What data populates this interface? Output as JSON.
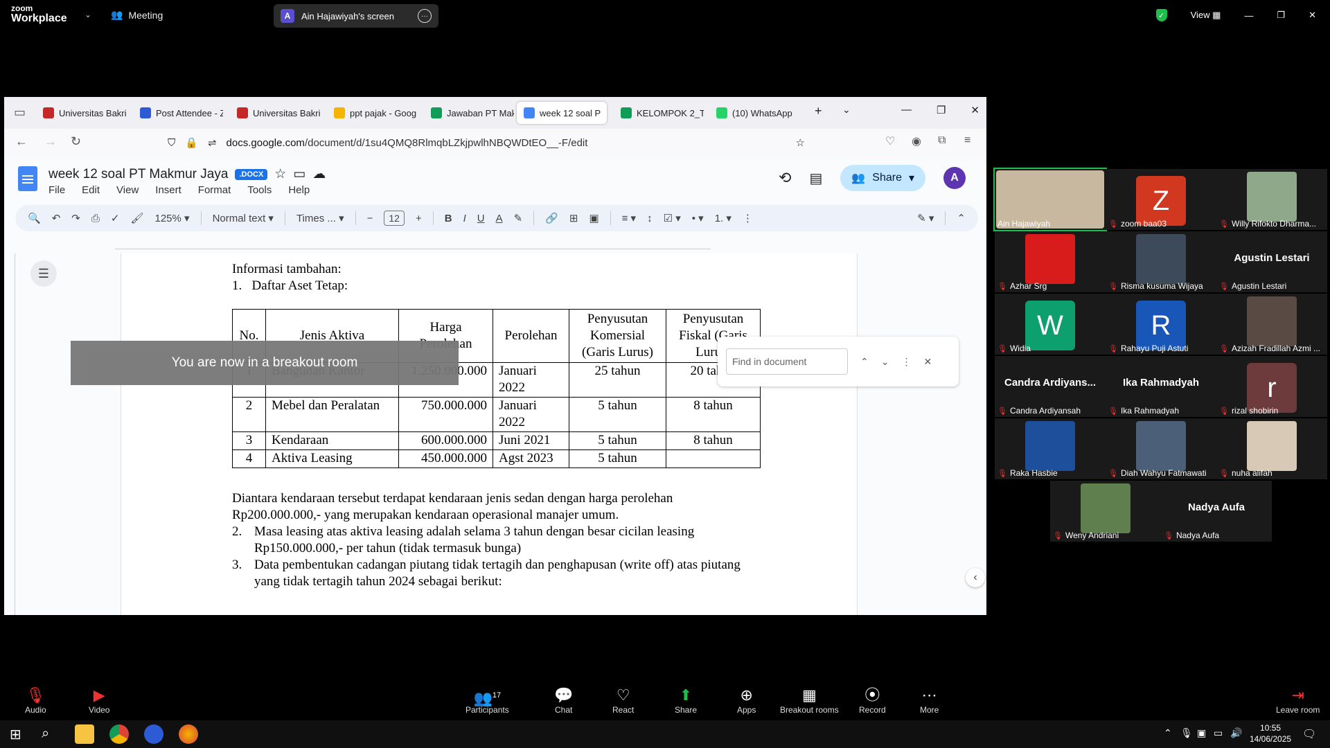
{
  "zoom": {
    "logo_line1": "zoom",
    "logo_line2": "Workplace",
    "meeting_label": "Meeting",
    "screen_share_initial": "A",
    "screen_share_label": "Ain Hajawiyah's screen",
    "view_label": "View"
  },
  "browser": {
    "tabs": [
      {
        "label": "Universitas Bakri",
        "color": "#c62828"
      },
      {
        "label": "Post Attendee - Z",
        "color": "#2d5bd6"
      },
      {
        "label": "Universitas Bakri",
        "color": "#c62828"
      },
      {
        "label": "ppt pajak - Goog",
        "color": "#f4b400"
      },
      {
        "label": "Jawaban PT Mak",
        "color": "#0f9d58"
      },
      {
        "label": "week 12 soal P",
        "color": "#4285f4"
      },
      {
        "label": "KELOMPOK 2_TU",
        "color": "#0f9d58"
      },
      {
        "label": "(10) WhatsApp",
        "color": "#25d366"
      }
    ],
    "url_prefix": "docs.google.com",
    "url_rest": "/document/d/1su4QMQ8RlmqbLZkjpwlhNBQWDtEO__-F/edit"
  },
  "docs": {
    "title": "week 12 soal PT Makmur Jaya",
    "badge": ".DOCX",
    "menu": [
      "File",
      "Edit",
      "View",
      "Insert",
      "Format",
      "Tools",
      "Help"
    ],
    "share_label": "Share",
    "avatar": "A",
    "zoom": "125%",
    "style": "Normal text",
    "font": "Times ...",
    "font_size": "12",
    "find_placeholder": "Find in document",
    "toast": "You are now in a breakout room"
  },
  "content": {
    "heading": "Informasi tambahan:",
    "item1": "1.   Daftar Aset Tetap:",
    "table_headers": [
      "No.",
      "Jenis Aktiva",
      "Harga Perolehan",
      "Perolehan",
      "Penyusutan Komersial (Garis Lurus)",
      "Penyusutan Fiskal (Garis Lurus)"
    ],
    "rows": [
      [
        "1",
        "Bangunan Kantor",
        "1.250.000.000",
        "Januari 2022",
        "25 tahun",
        "20 tahun"
      ],
      [
        "2",
        "Mebel dan Peralatan",
        "750.000.000",
        "Januari 2022",
        "5 tahun",
        "8 tahun"
      ],
      [
        "3",
        "Kendaraan",
        "600.000.000",
        "Juni 2021",
        "5 tahun",
        "8 tahun"
      ],
      [
        "4",
        "Aktiva Leasing",
        "450.000.000",
        "Agst 2023",
        "5 tahun",
        ""
      ]
    ],
    "para1": "Diantara kendaraan tersebut terdapat kendaraan jenis sedan dengan harga perolehan Rp200.000.000,- yang merupakan kendaraan operasional manajer umum.",
    "item2_num": "2.",
    "item2": "Masa leasing atas aktiva leasing adalah selama 3 tahun dengan besar cicilan leasing Rp150.000.000,- per tahun (tidak termasuk bunga)",
    "item3_num": "3.",
    "item3": "Data pembentukan cadangan piutang tidak tertagih dan penghapusan (write off) atas piutang yang tidak tertagih tahun 2024 sebagai berikut:"
  },
  "participants": [
    {
      "name": "Ain Hajawiyah",
      "kind": "photo",
      "color": "#c9b8a0",
      "active": true
    },
    {
      "name": "zoom baa03",
      "kind": "letter",
      "letter": "Z",
      "color": "#d2381f"
    },
    {
      "name": "Willy Rifokto Dharma...",
      "kind": "photo",
      "color": "#8fa88a"
    },
    {
      "name": "Azhar Srg",
      "kind": "photo",
      "color": "#d81b1b"
    },
    {
      "name": "Risma kusuma Wijaya",
      "kind": "photo",
      "color": "#3d4a5a"
    },
    {
      "name": "Agustin Lestari",
      "kind": "bigname"
    },
    {
      "name": "Widia",
      "kind": "letter",
      "letter": "W",
      "color": "#0e9f6e"
    },
    {
      "name": "Rahayu Puji Astuti",
      "kind": "letter",
      "letter": "R",
      "color": "#1857b8"
    },
    {
      "name": "Azizah Fradillah Azmi ...",
      "kind": "photo",
      "color": "#5a4a44"
    },
    {
      "name": "Candra Ardiyansah",
      "kind": "bigname",
      "big": "Candra  Ardiyans..."
    },
    {
      "name": "Ika Rahmadyah",
      "kind": "bigname"
    },
    {
      "name": "rizal shobirin",
      "kind": "letter",
      "letter": "r",
      "color": "#6d3b3b"
    },
    {
      "name": "Raka Hasbie",
      "kind": "photo",
      "color": "#1d4f9a"
    },
    {
      "name": "Diah Wahyu Fatmawati",
      "kind": "photo",
      "color": "#4c5f78"
    },
    {
      "name": "nuha alifah",
      "kind": "photo",
      "color": "#d7c9b5"
    },
    {
      "name": "Weny Andriani",
      "kind": "photo",
      "color": "#5f7f4f"
    },
    {
      "name": "Nadya Aufa",
      "kind": "bigname"
    }
  ],
  "controls": {
    "audio": "Audio",
    "video": "Video",
    "participants": "Participants",
    "participant_count": "17",
    "chat": "Chat",
    "react": "React",
    "share": "Share",
    "apps": "Apps",
    "breakout": "Breakout rooms",
    "record": "Record",
    "more": "More",
    "leave": "Leave room"
  },
  "taskbar": {
    "time": "10:55",
    "date": "14/06/2025"
  }
}
